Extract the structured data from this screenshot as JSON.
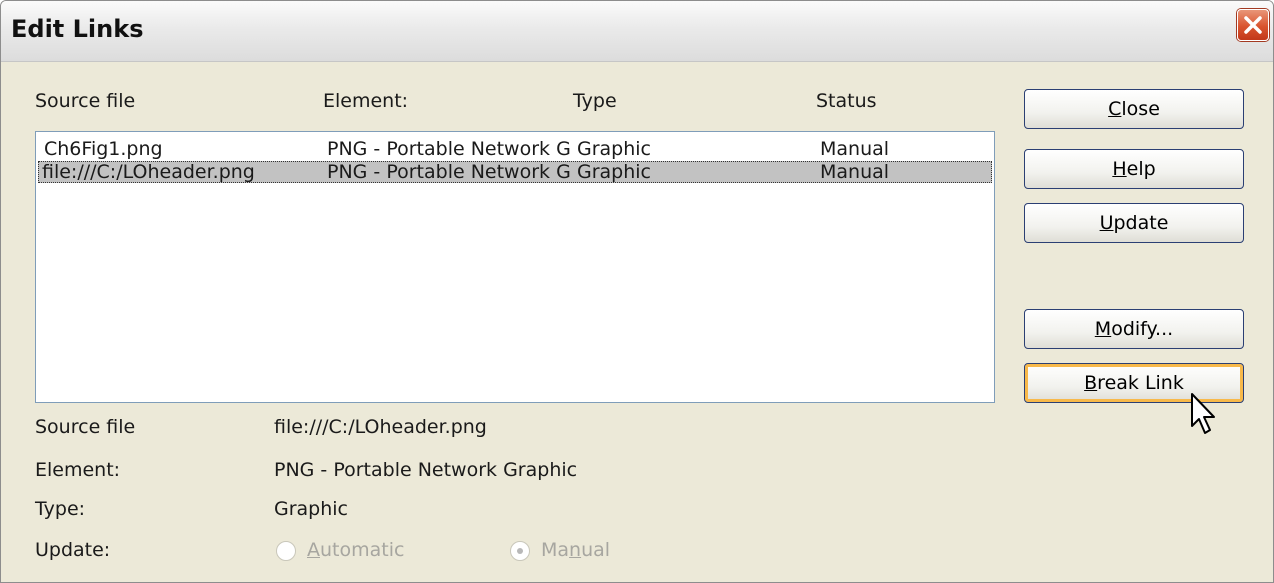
{
  "dialog": {
    "title": "Edit Links"
  },
  "columns": [
    "Source file",
    "Element:",
    "Type",
    "Status"
  ],
  "links": [
    {
      "source": "Ch6Fig1.png",
      "element": "PNG - Portable Network G",
      "type": "Graphic",
      "status": "Manual",
      "selected": false
    },
    {
      "source": "file:///C:/LOheader.png",
      "element": "PNG - Portable Network G",
      "type": "Graphic",
      "status": "Manual",
      "selected": true
    }
  ],
  "buttons": {
    "close": {
      "before": "",
      "key": "C",
      "after": "lose"
    },
    "help": {
      "before": "",
      "key": "H",
      "after": "elp"
    },
    "update": {
      "before": "",
      "key": "U",
      "after": "pdate"
    },
    "modify": {
      "before": "",
      "key": "M",
      "after": "odify..."
    },
    "break_link": {
      "before": "",
      "key": "B",
      "after": "reak Link"
    }
  },
  "details": {
    "source_label": "Source file",
    "source_value": "file:///C:/LOheader.png",
    "element_label": "Element:",
    "element_value": "PNG - Portable Network Graphic",
    "type_label": "Type:",
    "type_value": "Graphic",
    "update_label": "Update:",
    "automatic": {
      "before": "",
      "key": "A",
      "after": "utomatic",
      "checked": false
    },
    "manual": {
      "before": "Ma",
      "key": "n",
      "after": "ual",
      "checked": true
    }
  }
}
